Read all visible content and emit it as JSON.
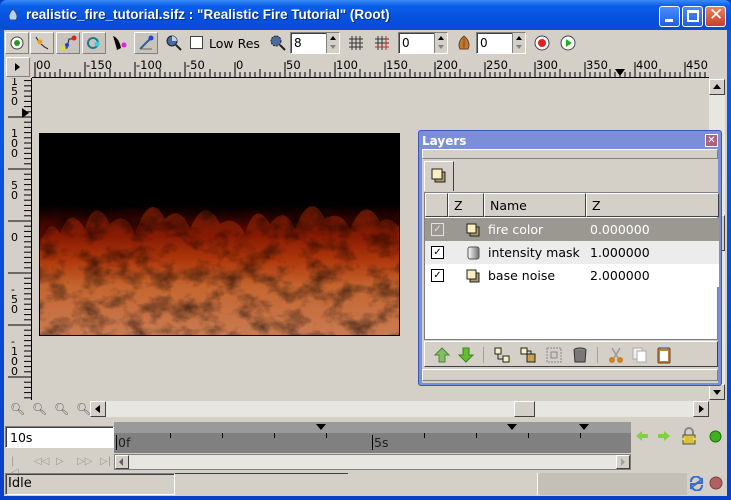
{
  "window": {
    "title": "realistic_fire_tutorial.sifz : \"Realistic Fire Tutorial\" (Root)",
    "buttons": [
      "minimize",
      "maximize",
      "close"
    ]
  },
  "toolbar": {
    "tools": [
      {
        "name": "transform-tool",
        "icon": "transform-icon"
      },
      {
        "name": "smooth-move-tool",
        "icon": "smooth-move-icon"
      },
      {
        "name": "spline-tool",
        "icon": "spline-icon"
      },
      {
        "name": "circle-tool",
        "icon": "circle-icon"
      },
      {
        "name": "draw-tool",
        "icon": "draw-icon"
      },
      {
        "name": "sketch-tool",
        "icon": "sketch-icon"
      }
    ],
    "lowres_label": "Low Res",
    "lowres_checked": false,
    "quality_value": "8",
    "grid_value_1": "0",
    "onion_value": "0"
  },
  "ruler_h": {
    "labels": [
      "00",
      "-150",
      "-100",
      "-50",
      "0",
      "50",
      "100",
      "150",
      "200",
      "250",
      "300",
      "350",
      "400",
      "450"
    ]
  },
  "ruler_v": {
    "labels": [
      "150",
      "100",
      "50",
      "0",
      "-50",
      "-100"
    ]
  },
  "layers_panel": {
    "title": "Layers",
    "columns": [
      "Z",
      "Name",
      "Z"
    ],
    "rows": [
      {
        "name": "fire color",
        "z": "0.000000",
        "checked": true,
        "selected": true,
        "icon": "group-layer-icon"
      },
      {
        "name": "intensity mask",
        "z": "1.000000",
        "checked": true,
        "selected": false,
        "icon": "gradient-layer-icon"
      },
      {
        "name": "base noise",
        "z": "2.000000",
        "checked": true,
        "selected": false,
        "icon": "group-layer-icon"
      }
    ]
  },
  "timebar": {
    "end_time": "10s",
    "labels": [
      "0f",
      "5s"
    ]
  },
  "status": {
    "text": "Idle"
  },
  "colors": {
    "titlebar": "#0a5ee8",
    "panel_bg": "#d4d0c8",
    "selected_row": "#9a9890",
    "layers_frame": "#7a8fd8"
  }
}
